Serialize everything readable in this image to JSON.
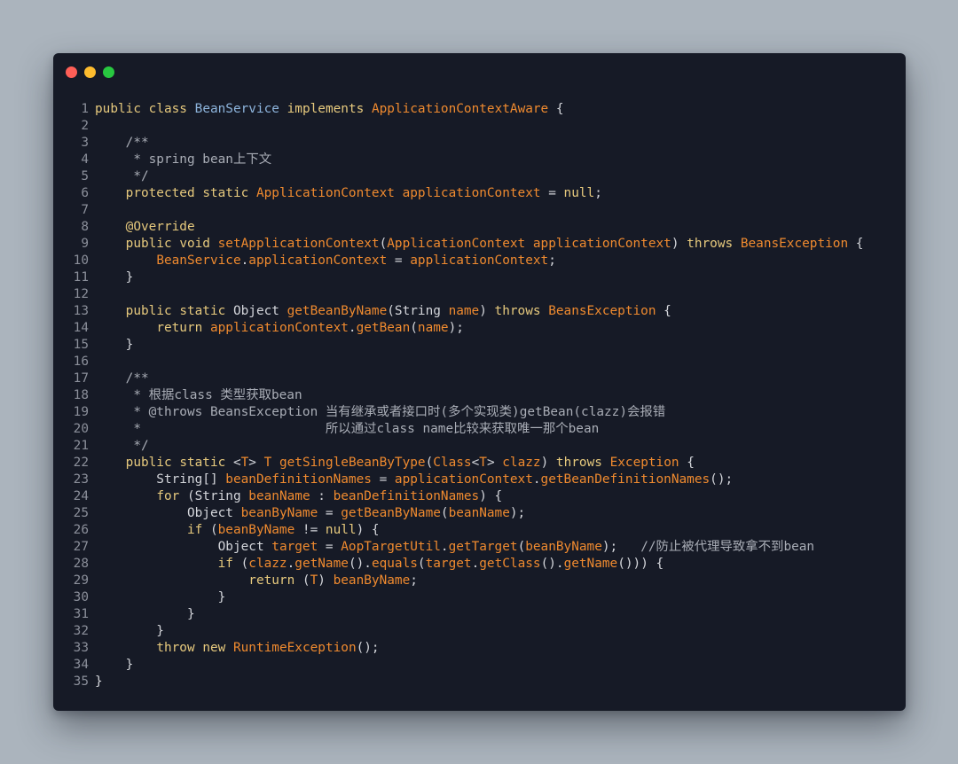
{
  "window": {
    "controls": [
      "close",
      "minimize",
      "maximize"
    ]
  },
  "colors": {
    "background": "#abb4bd",
    "editor": "#161a26",
    "keyword": "#e6c97d",
    "identifier": "#ef8a2f",
    "class_name": "#8db4dc",
    "plain": "#d4d6db",
    "comment": "#a9adb6",
    "line_number": "#8b8f9a"
  },
  "code": {
    "lines": [
      {
        "n": "1",
        "tokens": [
          [
            "kw",
            "public"
          ],
          [
            "plain",
            " "
          ],
          [
            "kw",
            "class"
          ],
          [
            "plain",
            " "
          ],
          [
            "type",
            "BeanService"
          ],
          [
            "plain",
            " "
          ],
          [
            "kw",
            "implements"
          ],
          [
            "plain",
            " "
          ],
          [
            "ident",
            "ApplicationContextAware"
          ],
          [
            "plain",
            " {"
          ]
        ]
      },
      {
        "n": "2",
        "tokens": []
      },
      {
        "n": "3",
        "tokens": [
          [
            "plain",
            "    "
          ],
          [
            "comment",
            "/**"
          ]
        ]
      },
      {
        "n": "4",
        "tokens": [
          [
            "plain",
            "    "
          ],
          [
            "comment",
            " * spring bean上下文"
          ]
        ]
      },
      {
        "n": "5",
        "tokens": [
          [
            "plain",
            "    "
          ],
          [
            "comment",
            " */"
          ]
        ]
      },
      {
        "n": "6",
        "tokens": [
          [
            "plain",
            "    "
          ],
          [
            "kw",
            "protected"
          ],
          [
            "plain",
            " "
          ],
          [
            "kw",
            "static"
          ],
          [
            "plain",
            " "
          ],
          [
            "ident",
            "ApplicationContext"
          ],
          [
            "plain",
            " "
          ],
          [
            "ident",
            "applicationContext"
          ],
          [
            "plain",
            " = "
          ],
          [
            "kw",
            "null"
          ],
          [
            "plain",
            ";"
          ]
        ]
      },
      {
        "n": "7",
        "tokens": []
      },
      {
        "n": "8",
        "tokens": [
          [
            "plain",
            "    "
          ],
          [
            "annot",
            "@Override"
          ]
        ]
      },
      {
        "n": "9",
        "tokens": [
          [
            "plain",
            "    "
          ],
          [
            "kw",
            "public"
          ],
          [
            "plain",
            " "
          ],
          [
            "kw",
            "void"
          ],
          [
            "plain",
            " "
          ],
          [
            "ident",
            "setApplicationContext"
          ],
          [
            "plain",
            "("
          ],
          [
            "ident",
            "ApplicationContext"
          ],
          [
            "plain",
            " "
          ],
          [
            "ident",
            "applicationContext"
          ],
          [
            "plain",
            ") "
          ],
          [
            "kw",
            "throws"
          ],
          [
            "plain",
            " "
          ],
          [
            "ident",
            "BeansException"
          ],
          [
            "plain",
            " {"
          ]
        ]
      },
      {
        "n": "10",
        "tokens": [
          [
            "plain",
            "        "
          ],
          [
            "ident",
            "BeanService"
          ],
          [
            "plain",
            "."
          ],
          [
            "ident",
            "applicationContext"
          ],
          [
            "plain",
            " = "
          ],
          [
            "ident",
            "applicationContext"
          ],
          [
            "plain",
            ";"
          ]
        ]
      },
      {
        "n": "11",
        "tokens": [
          [
            "plain",
            "    }"
          ]
        ]
      },
      {
        "n": "12",
        "tokens": []
      },
      {
        "n": "13",
        "tokens": [
          [
            "plain",
            "    "
          ],
          [
            "kw",
            "public"
          ],
          [
            "plain",
            " "
          ],
          [
            "kw",
            "static"
          ],
          [
            "plain",
            " Object "
          ],
          [
            "ident",
            "getBeanByName"
          ],
          [
            "plain",
            "(String "
          ],
          [
            "ident",
            "name"
          ],
          [
            "plain",
            ") "
          ],
          [
            "kw",
            "throws"
          ],
          [
            "plain",
            " "
          ],
          [
            "ident",
            "BeansException"
          ],
          [
            "plain",
            " {"
          ]
        ]
      },
      {
        "n": "14",
        "tokens": [
          [
            "plain",
            "        "
          ],
          [
            "kw",
            "return"
          ],
          [
            "plain",
            " "
          ],
          [
            "ident",
            "applicationContext"
          ],
          [
            "plain",
            "."
          ],
          [
            "ident",
            "getBean"
          ],
          [
            "plain",
            "("
          ],
          [
            "ident",
            "name"
          ],
          [
            "plain",
            ");"
          ]
        ]
      },
      {
        "n": "15",
        "tokens": [
          [
            "plain",
            "    }"
          ]
        ]
      },
      {
        "n": "16",
        "tokens": []
      },
      {
        "n": "17",
        "tokens": [
          [
            "plain",
            "    "
          ],
          [
            "comment",
            "/**"
          ]
        ]
      },
      {
        "n": "18",
        "tokens": [
          [
            "plain",
            "    "
          ],
          [
            "comment",
            " * 根据class 类型获取bean"
          ]
        ]
      },
      {
        "n": "19",
        "tokens": [
          [
            "plain",
            "    "
          ],
          [
            "comment",
            " * @throws BeansException 当有继承或者接口时(多个实现类)getBean(clazz)会报错"
          ]
        ]
      },
      {
        "n": "20",
        "tokens": [
          [
            "plain",
            "    "
          ],
          [
            "comment",
            " *                        所以通过class name比较来获取唯一那个bean"
          ]
        ]
      },
      {
        "n": "21",
        "tokens": [
          [
            "plain",
            "    "
          ],
          [
            "comment",
            " */"
          ]
        ]
      },
      {
        "n": "22",
        "tokens": [
          [
            "plain",
            "    "
          ],
          [
            "kw",
            "public"
          ],
          [
            "plain",
            " "
          ],
          [
            "kw",
            "static"
          ],
          [
            "plain",
            " <"
          ],
          [
            "ident",
            "T"
          ],
          [
            "plain",
            "> "
          ],
          [
            "ident",
            "T"
          ],
          [
            "plain",
            " "
          ],
          [
            "ident",
            "getSingleBeanByType"
          ],
          [
            "plain",
            "("
          ],
          [
            "ident",
            "Class"
          ],
          [
            "plain",
            "<"
          ],
          [
            "ident",
            "T"
          ],
          [
            "plain",
            "> "
          ],
          [
            "ident",
            "clazz"
          ],
          [
            "plain",
            ") "
          ],
          [
            "kw",
            "throws"
          ],
          [
            "plain",
            " "
          ],
          [
            "ident",
            "Exception"
          ],
          [
            "plain",
            " {"
          ]
        ]
      },
      {
        "n": "23",
        "tokens": [
          [
            "plain",
            "        String[] "
          ],
          [
            "ident",
            "beanDefinitionNames"
          ],
          [
            "plain",
            " = "
          ],
          [
            "ident",
            "applicationContext"
          ],
          [
            "plain",
            "."
          ],
          [
            "ident",
            "getBeanDefinitionNames"
          ],
          [
            "plain",
            "();"
          ]
        ]
      },
      {
        "n": "24",
        "tokens": [
          [
            "plain",
            "        "
          ],
          [
            "kw",
            "for"
          ],
          [
            "plain",
            " (String "
          ],
          [
            "ident",
            "beanName"
          ],
          [
            "plain",
            " : "
          ],
          [
            "ident",
            "beanDefinitionNames"
          ],
          [
            "plain",
            ") {"
          ]
        ]
      },
      {
        "n": "25",
        "tokens": [
          [
            "plain",
            "            Object "
          ],
          [
            "ident",
            "beanByName"
          ],
          [
            "plain",
            " = "
          ],
          [
            "ident",
            "getBeanByName"
          ],
          [
            "plain",
            "("
          ],
          [
            "ident",
            "beanName"
          ],
          [
            "plain",
            ");"
          ]
        ]
      },
      {
        "n": "26",
        "tokens": [
          [
            "plain",
            "            "
          ],
          [
            "kw",
            "if"
          ],
          [
            "plain",
            " ("
          ],
          [
            "ident",
            "beanByName"
          ],
          [
            "plain",
            " != "
          ],
          [
            "kw",
            "null"
          ],
          [
            "plain",
            ") {"
          ]
        ]
      },
      {
        "n": "27",
        "tokens": [
          [
            "plain",
            "                Object "
          ],
          [
            "ident",
            "target"
          ],
          [
            "plain",
            " = "
          ],
          [
            "ident",
            "AopTargetUtil"
          ],
          [
            "plain",
            "."
          ],
          [
            "ident",
            "getTarget"
          ],
          [
            "plain",
            "("
          ],
          [
            "ident",
            "beanByName"
          ],
          [
            "plain",
            ");   "
          ],
          [
            "comment",
            "//防止被代理导致拿不到bean"
          ]
        ]
      },
      {
        "n": "28",
        "tokens": [
          [
            "plain",
            "                "
          ],
          [
            "kw",
            "if"
          ],
          [
            "plain",
            " ("
          ],
          [
            "ident",
            "clazz"
          ],
          [
            "plain",
            "."
          ],
          [
            "ident",
            "getName"
          ],
          [
            "plain",
            "()."
          ],
          [
            "ident",
            "equals"
          ],
          [
            "plain",
            "("
          ],
          [
            "ident",
            "target"
          ],
          [
            "plain",
            "."
          ],
          [
            "ident",
            "getClass"
          ],
          [
            "plain",
            "()."
          ],
          [
            "ident",
            "getName"
          ],
          [
            "plain",
            "())) {"
          ]
        ]
      },
      {
        "n": "29",
        "tokens": [
          [
            "plain",
            "                    "
          ],
          [
            "kw",
            "return"
          ],
          [
            "plain",
            " ("
          ],
          [
            "ident",
            "T"
          ],
          [
            "plain",
            ") "
          ],
          [
            "ident",
            "beanByName"
          ],
          [
            "plain",
            ";"
          ]
        ]
      },
      {
        "n": "30",
        "tokens": [
          [
            "plain",
            "                }"
          ]
        ]
      },
      {
        "n": "31",
        "tokens": [
          [
            "plain",
            "            }"
          ]
        ]
      },
      {
        "n": "32",
        "tokens": [
          [
            "plain",
            "        }"
          ]
        ]
      },
      {
        "n": "33",
        "tokens": [
          [
            "plain",
            "        "
          ],
          [
            "kw",
            "throw"
          ],
          [
            "plain",
            " "
          ],
          [
            "kw",
            "new"
          ],
          [
            "plain",
            " "
          ],
          [
            "ident",
            "RuntimeException"
          ],
          [
            "plain",
            "();"
          ]
        ]
      },
      {
        "n": "34",
        "tokens": [
          [
            "plain",
            "    }"
          ]
        ]
      },
      {
        "n": "35",
        "tokens": [
          [
            "plain",
            "}"
          ]
        ]
      }
    ]
  }
}
